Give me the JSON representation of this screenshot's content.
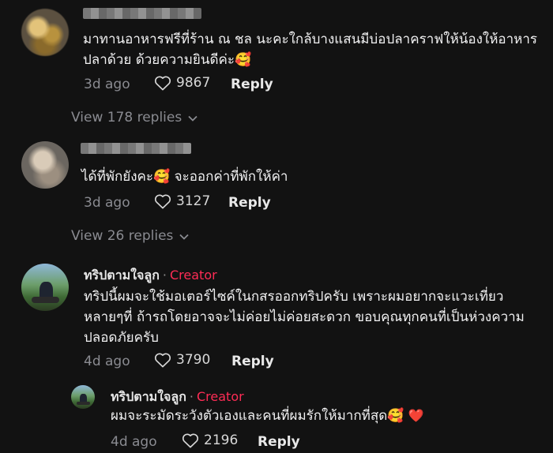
{
  "comments": [
    {
      "author": "",
      "text": "มาทานอาหารฟรีที่ร้าน ณ ชล นะคะใกล้บางแสนมีบ่อปลาคราฟให้น้องให้อาหารปลาด้วย ด้วยความยินดีค่ะ🥰",
      "time": "3d ago",
      "likes": "9867",
      "reply_label": "Reply",
      "view_replies": "View 178 replies"
    },
    {
      "author": "",
      "text": "ได้ที่พักยังคะ🥰 จะออกค่าที่พักให้ค่า",
      "time": "3d ago",
      "likes": "3127",
      "reply_label": "Reply",
      "view_replies": "View 26 replies"
    },
    {
      "author": "ทริปตามใจลูก",
      "badge": "Creator",
      "text": "ทริปนี้ผมจะใช้มอเตอร์ไซค์ในกสรออกทริปครับ เพราะผมอยากจะแวะเที่ยวหลายๆที่ ถ้ารถโดยอาจจะไม่ค่อยไม่ค่อยสะดวก ขอบคุณทุกคนที่เป็นห่วงความปลอดภัยครับ",
      "time": "4d ago",
      "likes": "3790",
      "reply_label": "Reply"
    },
    {
      "author": "ทริปตามใจลูก",
      "badge": "Creator",
      "text": "ผมจะระมัดระวังตัวเองและคนที่ผมรักให้มากที่สุด🥰",
      "heart": "❤️",
      "time": "4d ago",
      "likes": "2196",
      "reply_label": "Reply"
    }
  ],
  "separator": "·",
  "chevron": "⌄"
}
